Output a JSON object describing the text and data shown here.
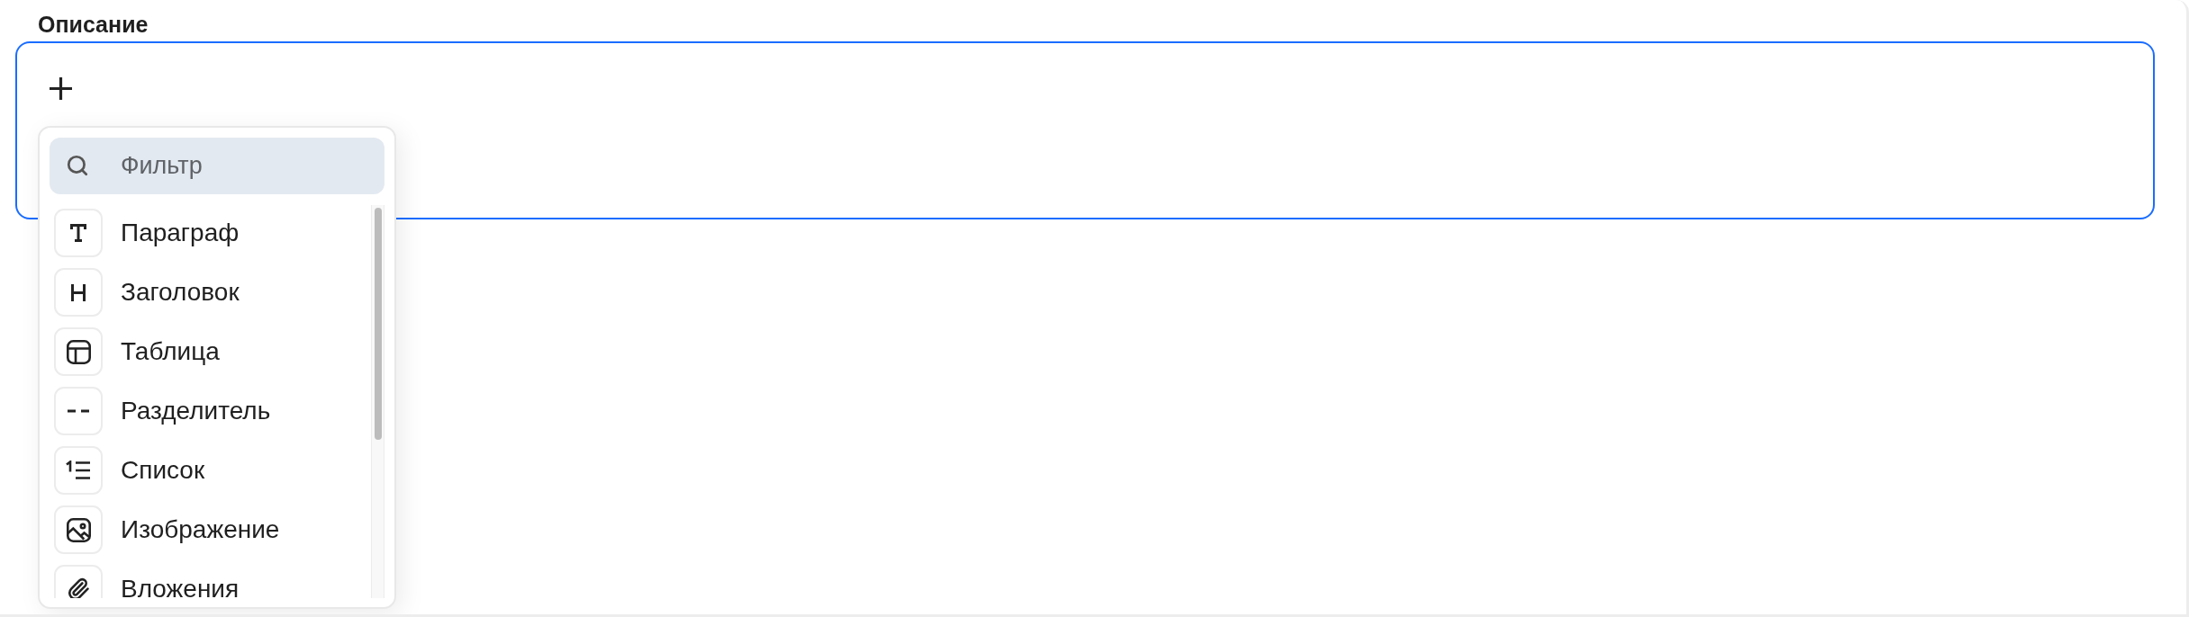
{
  "field": {
    "label": "Описание"
  },
  "editor": {
    "focused": true
  },
  "block_menu": {
    "filter": {
      "placeholder": "Фильтр"
    },
    "items": [
      {
        "kind": "paragraph",
        "label": "Параграф"
      },
      {
        "kind": "heading",
        "label": "Заголовок"
      },
      {
        "kind": "table",
        "label": "Таблица"
      },
      {
        "kind": "divider",
        "label": "Разделитель"
      },
      {
        "kind": "list",
        "label": "Список"
      },
      {
        "kind": "image",
        "label": "Изображение"
      },
      {
        "kind": "attachment",
        "label": "Вложения"
      }
    ]
  }
}
